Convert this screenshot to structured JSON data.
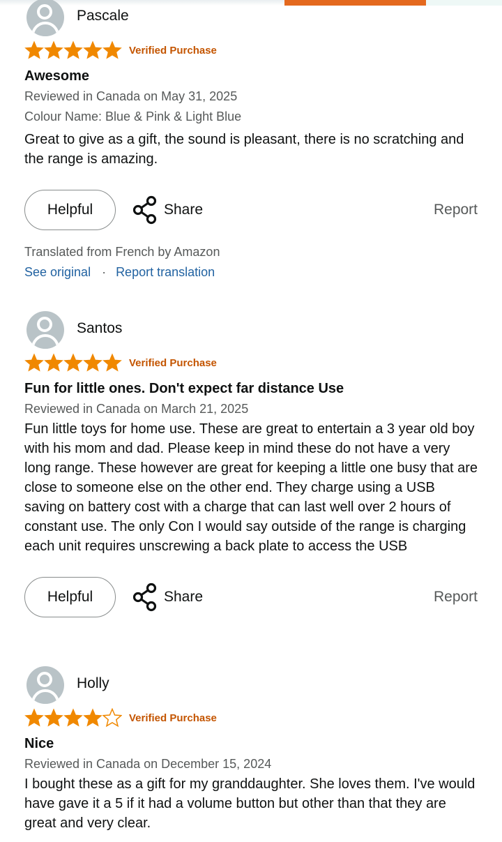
{
  "colors": {
    "accent": "#e4691e",
    "star": "#f08800",
    "verified": "#c45500",
    "link": "#2162a1"
  },
  "reviews": [
    {
      "name": "Pascale",
      "rating": 5,
      "verified": "Verified Purchase",
      "title": "Awesome",
      "date": "Reviewed in Canada on May 31, 2025",
      "variant": "Colour Name: Blue & Pink & Light Blue",
      "text": "Great to give as a gift, the sound is pleasant, there is no scratching and the range is amazing.",
      "helpful": "Helpful",
      "share": "Share",
      "report": "Report",
      "translated": "Translated from French by Amazon",
      "see_original": "See original",
      "separator": "·",
      "report_translation": "Report translation"
    },
    {
      "name": "Santos",
      "rating": 5,
      "verified": "Verified Purchase",
      "title": "Fun for little ones. Don't expect far distance Use",
      "date": "Reviewed in Canada on March 21, 2025",
      "text": "Fun little toys for home use. These are great to entertain a 3 year old boy with his mom and dad. Please keep in mind these do not have a very long range. These however are great for keeping a little one busy that are close to someone else on the other end. They charge using a USB saving on battery cost with a charge that can last well over 2 hours of constant use. The only Con I would say outside of the range is charging each unit requires unscrewing a back plate to access the USB",
      "helpful": "Helpful",
      "share": "Share",
      "report": "Report"
    },
    {
      "name": "Holly",
      "rating": 4,
      "verified": "Verified Purchase",
      "title": "Nice",
      "date": "Reviewed in Canada on December 15, 2024",
      "text": "I bought these as a gift for my granddaughter. She loves them. I've would have gave it a 5 if it had a volume button but other than that they are great and very clear."
    }
  ]
}
